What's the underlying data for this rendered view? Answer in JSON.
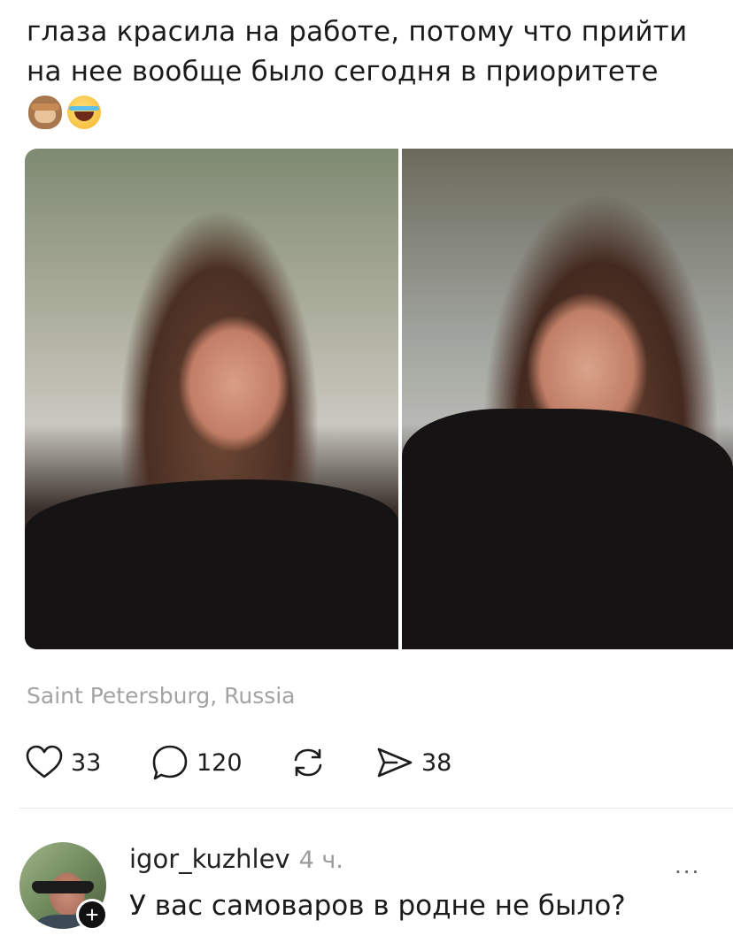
{
  "post": {
    "text": "глаза красила на работе, потому что прийти на нее вообще было сегодня в приоритете",
    "emojis": [
      "see-no-evil-monkey-emoji",
      "tears-of-joy-emoji"
    ],
    "location": "Saint Petersburg, Russia"
  },
  "actions": {
    "likes": "33",
    "comments": "120",
    "reposts": "",
    "shares": "38"
  },
  "comment": {
    "username": "igor_kuzhlev",
    "time": "4 ч.",
    "text": "У вас самоваров в родне не было?",
    "more": "...",
    "badge": "+"
  }
}
